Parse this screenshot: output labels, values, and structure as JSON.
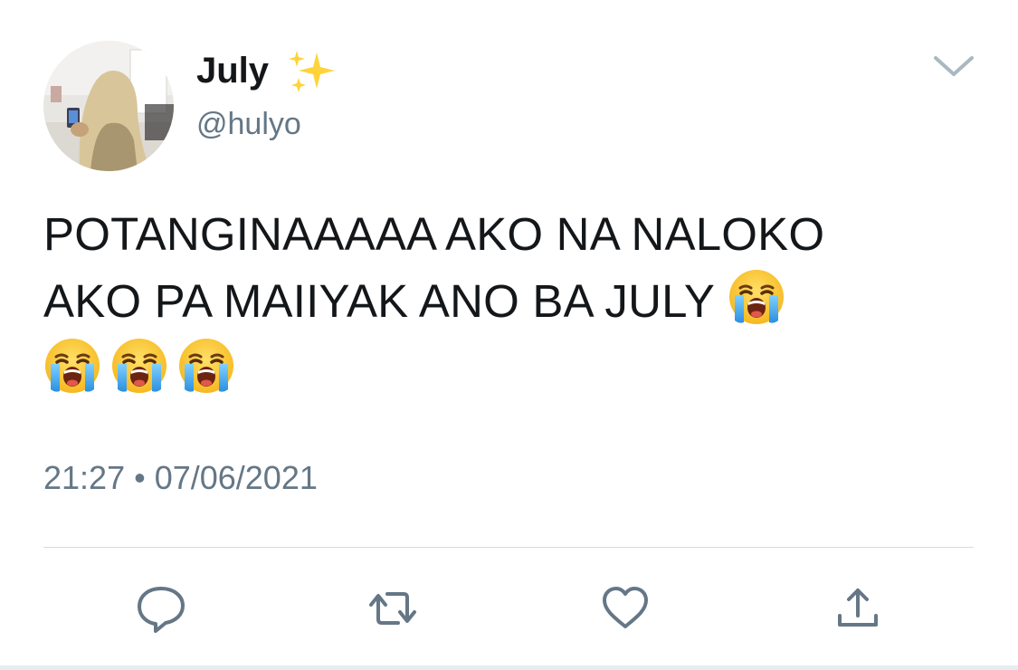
{
  "tweet": {
    "author": {
      "display_name": "July",
      "name_emoji": "sparkles-emoji",
      "handle": "@hulyo",
      "avatar": "avatar-photo"
    },
    "text_lines": [
      "POTANGINAAAAA AKO NA NALOKO",
      "AKO PA MAIIYAK ANO BA JULY"
    ],
    "emojis": [
      "loudly-crying-face",
      "loudly-crying-face",
      "loudly-crying-face",
      "loudly-crying-face"
    ],
    "timestamp": "21:27 • 07/06/2021"
  },
  "actions": [
    {
      "name": "reply",
      "icon": "reply-icon"
    },
    {
      "name": "retweet",
      "icon": "retweet-icon"
    },
    {
      "name": "like",
      "icon": "heart-icon"
    },
    {
      "name": "share",
      "icon": "share-icon"
    }
  ],
  "colors": {
    "text": "#14171a",
    "secondary": "#657786",
    "icon": "#657786",
    "divider": "#d7dbdf"
  }
}
